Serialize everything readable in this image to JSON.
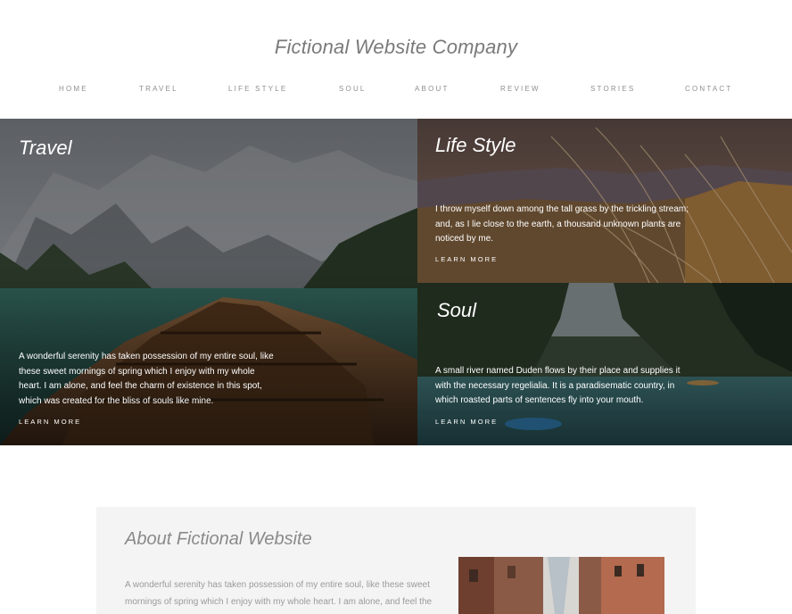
{
  "site": {
    "title": "Fictional Website Company"
  },
  "nav": [
    "HOME",
    "TRAVEL",
    "LIFE STYLE",
    "SOUL",
    "ABOUT",
    "REVIEW",
    "STORIES",
    "CONTACT"
  ],
  "cards": {
    "travel": {
      "title": "Travel",
      "text": "A wonderful serenity has taken possession of my entire soul, like these sweet mornings of spring which I enjoy with my whole heart. I am alone, and feel the charm of existence in this spot, which was created for the bliss of souls like mine.",
      "link": "LEARN MORE"
    },
    "lifestyle": {
      "title": "Life Style",
      "text": "I throw myself down among the tall grass by the trickling stream; and, as I lie close to the earth, a thousand unknown plants are noticed by me.",
      "link": "LEARN MORE"
    },
    "soul": {
      "title": "Soul",
      "text": "A small river named Duden flows by their place and supplies it with the necessary regelialia. It is a paradisematic country, in which roasted parts of sentences fly into your mouth.",
      "link": "LEARN MORE"
    }
  },
  "about": {
    "title": "About Fictional Website",
    "text": "A wonderful serenity has taken possession of my entire soul, like these sweet mornings of spring which I enjoy with my whole heart. I am alone, and feel the"
  }
}
